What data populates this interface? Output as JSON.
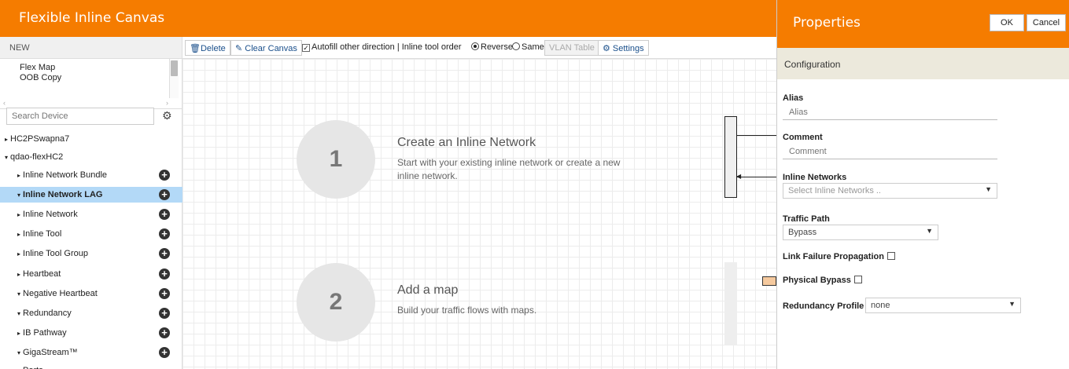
{
  "header": {
    "title": "Flexible Inline Canvas"
  },
  "sidebar": {
    "new_label": "NEW",
    "maps": [
      "Flex Map",
      "OOB Copy"
    ],
    "search_placeholder": "Search Device",
    "tree": [
      {
        "label": "HC2PSwapna7",
        "caret": "▸",
        "plus": false
      },
      {
        "label": "qdao-flexHC2",
        "caret": "▾",
        "plus": false
      },
      {
        "label": "Inline Network Bundle",
        "caret": "▸",
        "plus": true
      },
      {
        "label": "Inline Network LAG",
        "caret": "▾",
        "plus": true,
        "selected": true
      },
      {
        "label": "Inline Network",
        "caret": "▸",
        "plus": true
      },
      {
        "label": "Inline Tool",
        "caret": "▸",
        "plus": true
      },
      {
        "label": "Inline Tool Group",
        "caret": "▸",
        "plus": true
      },
      {
        "label": "Heartbeat",
        "caret": "▸",
        "plus": true
      },
      {
        "label": "Negative Heartbeat",
        "caret": "▾",
        "plus": true
      },
      {
        "label": "Redundancy",
        "caret": "▾",
        "plus": true
      },
      {
        "label": "IB Pathway",
        "caret": "▸",
        "plus": true
      },
      {
        "label": "GigaStream™",
        "caret": "▾",
        "plus": true
      },
      {
        "label": "Ports",
        "caret": "▾",
        "plus": false
      }
    ]
  },
  "toolbar": {
    "delete_label": "Delete",
    "clear_label": "Clear Canvas",
    "autofill_label": "Autofill other direction | Inline tool order",
    "reverse_label": "Reverse",
    "same_label": "Same",
    "vlan_label": "VLAN Table",
    "settings_label": "Settings"
  },
  "canvas": {
    "step1": {
      "number": "1",
      "title": "Create an Inline Network",
      "desc": "Start with your existing inline network or create a new inline network."
    },
    "step2": {
      "number": "2",
      "title": "Add a map",
      "desc": "Build your traffic flows with maps."
    }
  },
  "properties": {
    "title": "Properties",
    "ok_label": "OK",
    "cancel_label": "Cancel",
    "section": "Configuration",
    "alias_label": "Alias",
    "alias_placeholder": "Alias",
    "comment_label": "Comment",
    "comment_placeholder": "Comment",
    "inline_networks_label": "Inline Networks",
    "inline_networks_placeholder": "Select Inline Networks ..",
    "traffic_path_label": "Traffic Path",
    "traffic_path_value": "Bypass",
    "link_failure_label": "Link Failure Propagation",
    "physical_bypass_label": "Physical Bypass",
    "redundancy_label": "Redundancy Profile",
    "redundancy_value": "none"
  },
  "colors": {
    "brand": "#f57c00",
    "selected_row": "#b3d9f7",
    "config_bar": "#ece9dc"
  }
}
